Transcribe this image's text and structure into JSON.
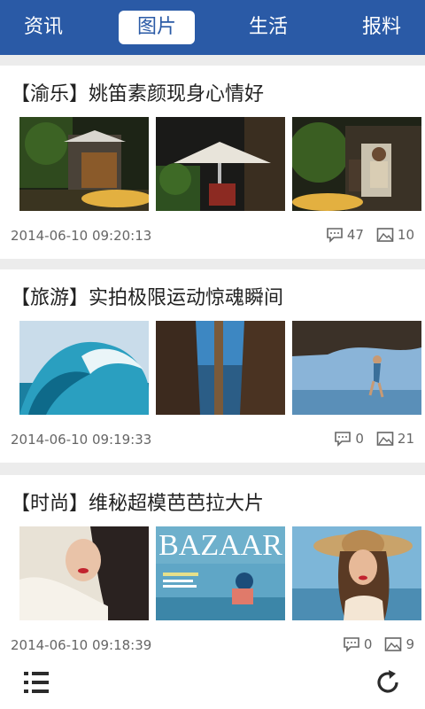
{
  "tabs": [
    {
      "label": "资讯"
    },
    {
      "label": "图片"
    },
    {
      "label": "生活"
    },
    {
      "label": "报料"
    }
  ],
  "active_tab": 1,
  "colors": {
    "accent": "#2a5aa6",
    "background": "#ececec",
    "text_meta": "#666666"
  },
  "articles": [
    {
      "title": "【渝乐】姚笛素颜现身心情好",
      "date": "2014-06-10 09:20:13",
      "comments": "47",
      "images": "10"
    },
    {
      "title": "【旅游】实拍极限运动惊魂瞬间",
      "date": "2014-06-10 09:19:33",
      "comments": "0",
      "images": "21"
    },
    {
      "title": "【时尚】维秘超模芭芭拉大片",
      "date": "2014-06-10 09:18:39",
      "comments": "0",
      "images": "9"
    }
  ],
  "thumb_text": {
    "bazaar": "BAZAAR"
  },
  "bottom": {
    "menu_icon": "list-menu-icon",
    "refresh_icon": "refresh-icon"
  }
}
